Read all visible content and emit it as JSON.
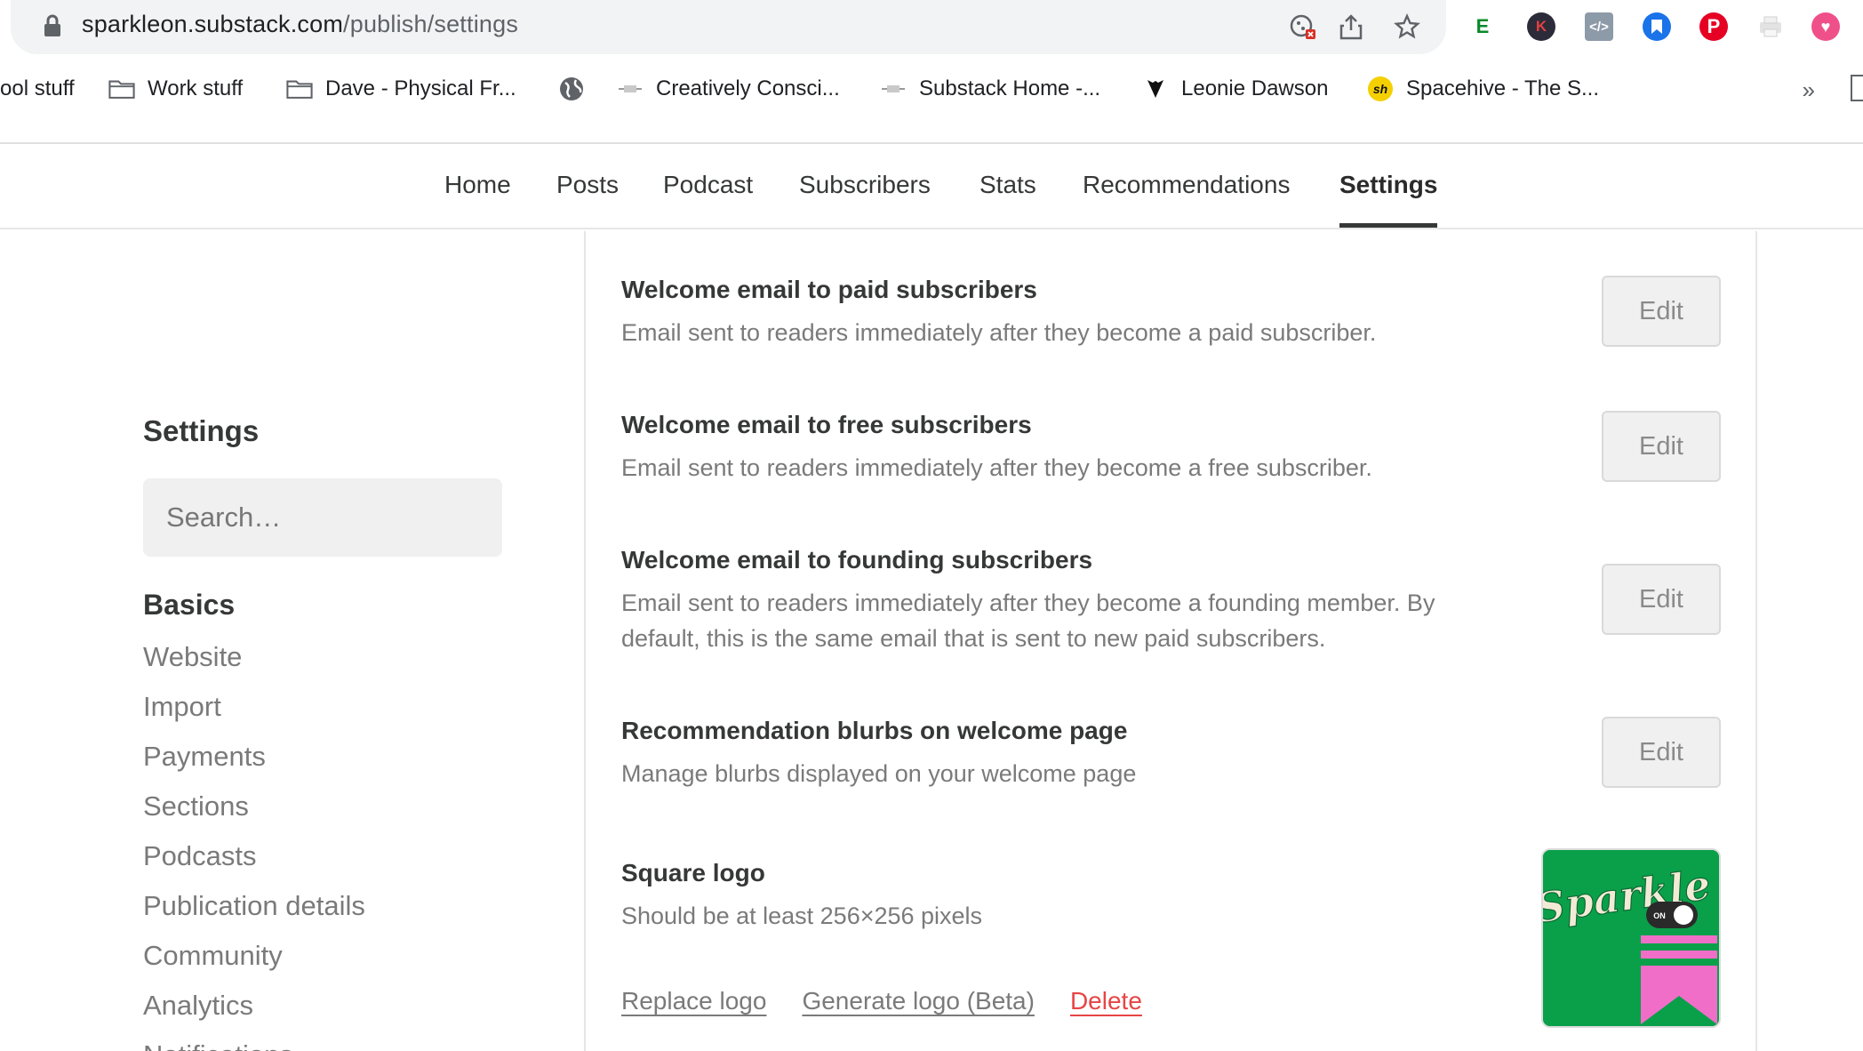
{
  "browser": {
    "url_domain": "sparkleon.substack.com",
    "url_path": "/publish/settings",
    "bookmarks": [
      {
        "label": "ool stuff",
        "icon": "folder-icon"
      },
      {
        "label": "Work stuff",
        "icon": "folder-icon"
      },
      {
        "label": "Dave - Physical Fr...",
        "icon": "folder-icon"
      },
      {
        "label": "",
        "icon": "globe-icon"
      },
      {
        "label": "Creatively Consci...",
        "icon": "site-favicon"
      },
      {
        "label": "Substack Home -...",
        "icon": "site-favicon"
      },
      {
        "label": "Leonie Dawson",
        "icon": "heart-icon"
      },
      {
        "label": "Spacehive - The S...",
        "icon": "sh-favicon"
      }
    ],
    "more_label": "»",
    "colors": {
      "chrome_bg": "#ffffff",
      "omnibox_bg": "#f1f3f4"
    }
  },
  "nav": {
    "tabs": [
      "Home",
      "Posts",
      "Podcast",
      "Subscribers",
      "Stats",
      "Recommendations",
      "Settings"
    ],
    "active_tab": "Settings"
  },
  "sidebar": {
    "title": "Settings",
    "search_placeholder": "Search…",
    "group": "Basics",
    "items": [
      "Website",
      "Import",
      "Payments",
      "Sections",
      "Podcasts",
      "Publication details",
      "Community",
      "Analytics",
      "Notifications"
    ]
  },
  "settings": [
    {
      "title": "Welcome email to paid subscribers",
      "description": "Email sent to readers immediately after they become a paid subscriber.",
      "action": "Edit"
    },
    {
      "title": "Welcome email to free subscribers",
      "description": "Email sent to readers immediately after they become a free subscriber.",
      "action": "Edit"
    },
    {
      "title": "Welcome email to founding subscribers",
      "description": "Email sent to readers immediately after they become a founding member. By default, this is the same email that is sent to new paid subscribers.",
      "action": "Edit"
    },
    {
      "title": "Recommendation blurbs on welcome page",
      "description": "Manage blurbs displayed on your welcome page",
      "action": "Edit"
    }
  ],
  "logo_section": {
    "title": "Square logo",
    "description": "Should be at least 256×256 pixels",
    "replace_label": "Replace logo",
    "generate_label": "Generate logo (Beta)",
    "delete_label": "Delete",
    "logo_text": "Sparkle",
    "logo_toggle_text": "ON",
    "colors": {
      "logo_bg": "#0aa04a",
      "logo_pink": "#f06ec8",
      "danger": "#e64545"
    }
  }
}
